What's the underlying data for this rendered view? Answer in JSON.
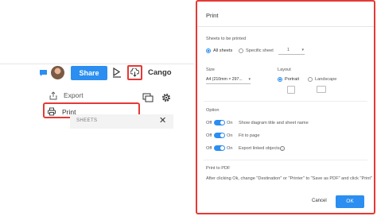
{
  "toolbar": {
    "share_label": "Share",
    "user_name": "Cango"
  },
  "menu": {
    "export_label": "Export",
    "print_label": "Print"
  },
  "sheets_panel": {
    "title": "SHEETS"
  },
  "dialog": {
    "title": "Print",
    "sheets_to_print_label": "Sheets to be printed",
    "all_sheets_label": "All sheets",
    "specific_sheet_label": "Specific sheet",
    "specific_sheet_value": "1",
    "size_label": "Size",
    "size_value": "A4 (210mm × 297...",
    "layout_label": "Layout",
    "portrait_label": "Portrait",
    "landscape_label": "Landscape",
    "option_label": "Option",
    "off_label": "Off",
    "on_label": "On",
    "options": [
      "Show diagram title and sheet name",
      "Fit to page",
      "Export linked objects"
    ],
    "print_to_pdf_label": "Print to PDF",
    "pdf_instructions": "After clicking Ok, change \"Destination\" or \"Printer\" to \"Save as PDF\" and click \"Print\"",
    "cancel_label": "Cancel",
    "ok_label": "OK"
  },
  "colors": {
    "accent": "#2b8ef0",
    "highlight": "#e53935"
  }
}
